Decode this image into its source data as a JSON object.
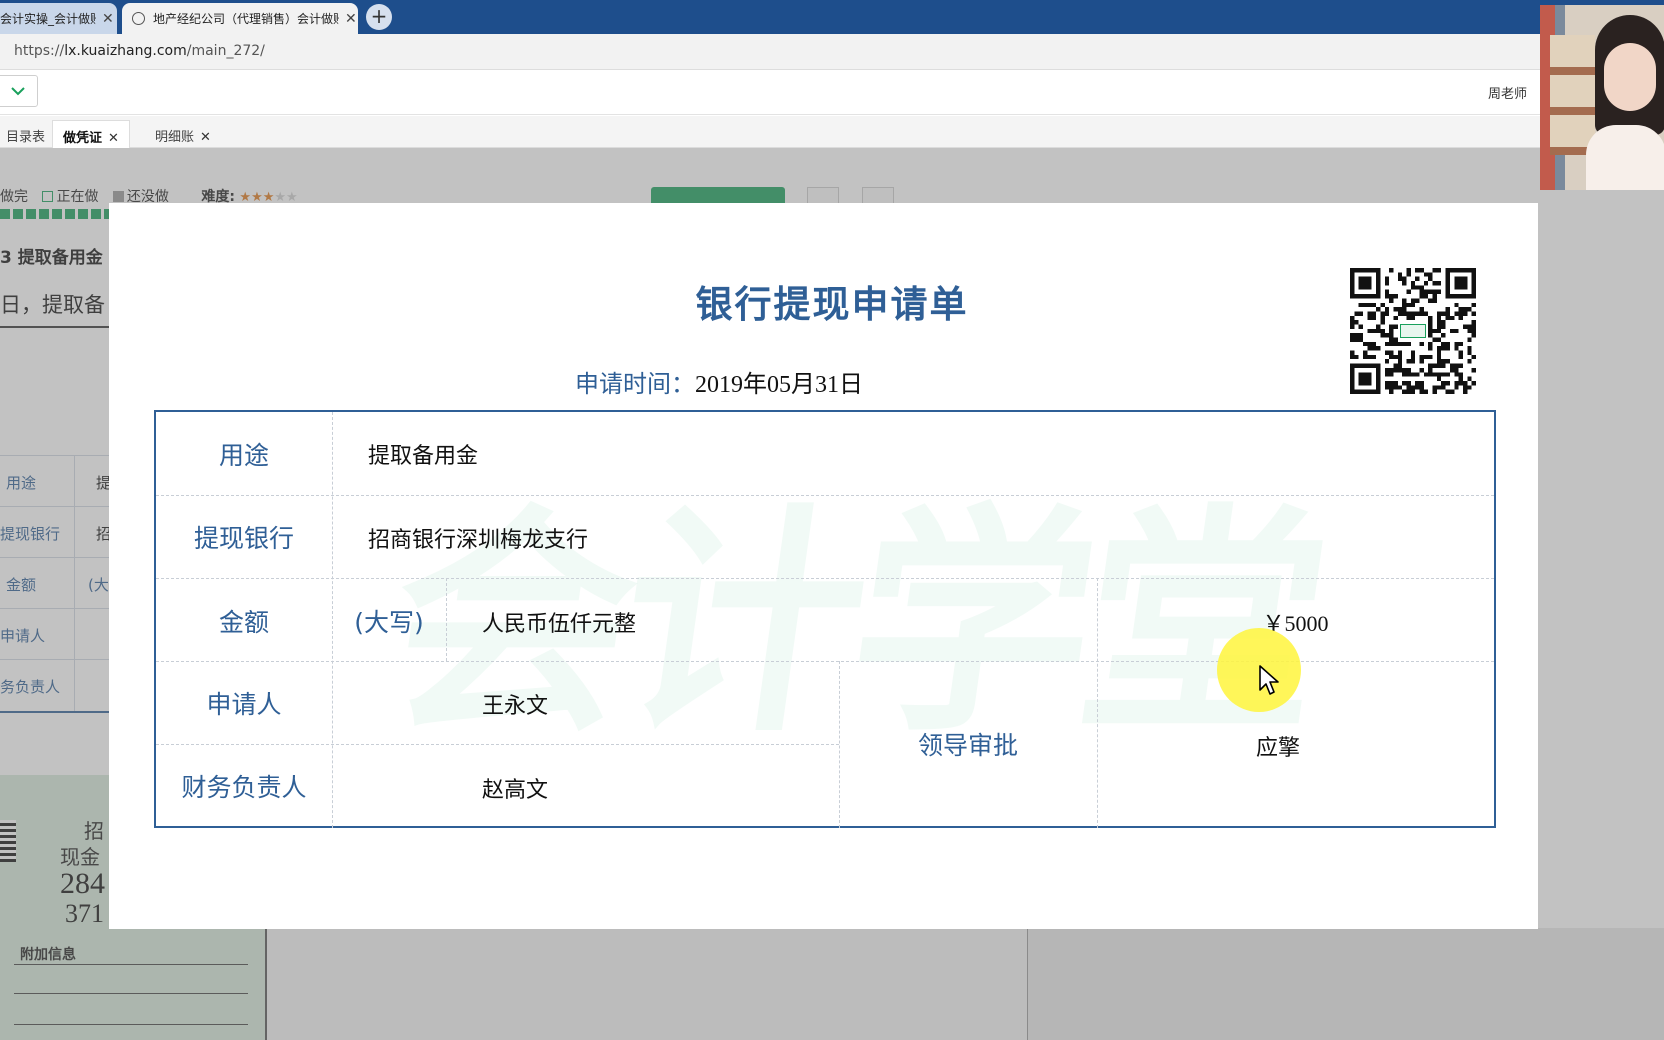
{
  "browser": {
    "tabs": [
      {
        "title": "会计实操_会计做账",
        "active": false
      },
      {
        "title": "地产经纪公司（代理销售）会计做账",
        "active": true
      }
    ],
    "new_tab": "+",
    "url_scheme": "https://",
    "url_host": "lx.kuaizhang.com",
    "url_path": "/main_272/"
  },
  "app": {
    "teacher": "周老师",
    "nav_tabs": [
      {
        "label": "目录表",
        "closable": false,
        "active": false
      },
      {
        "label": "做凭证",
        "closable": true,
        "active": true
      },
      {
        "label": "明细账",
        "closable": true,
        "active": false
      }
    ],
    "close_glyph": "✕",
    "legend": {
      "done": "做完",
      "in_progress": "正在做",
      "not_done": "还没做"
    },
    "difficulty_label": "难度:",
    "difficulty_stars": 3,
    "difficulty_max": 5,
    "task_title": "3 提取备用金",
    "task_desc": "日，提取备",
    "left_rows": [
      "用途",
      "提现银行",
      "金额",
      "申请人",
      "务负责人"
    ],
    "left_values": [
      "提",
      "招",
      "(大"
    ],
    "receipt": {
      "line1": "招",
      "line2": "现金",
      "num1": "284",
      "num2": "371",
      "additional": "附加信息"
    }
  },
  "form": {
    "title": "银行提现申请单",
    "date_label": "申请时间：",
    "date_value": "2019年05月31日",
    "purpose_label": "用途",
    "purpose_value": "提取备用金",
    "bank_label": "提现银行",
    "bank_value": "招商银行深圳梅龙支行",
    "amount_label": "金额",
    "amount_upper_label": "(大写)",
    "amount_upper_value": "人民币伍仟元整",
    "amount_value": "￥5000",
    "applicant_label": "申请人",
    "applicant_value": "王永文",
    "finance_label": "财务负责人",
    "finance_value": "赵高文",
    "approval_label": "领导审批",
    "approval_value": "应擎"
  },
  "watermark": "会计学堂",
  "colors": {
    "accent": "#2f5f96",
    "green": "#19a05c",
    "tabbar": "#1e4e8c"
  }
}
